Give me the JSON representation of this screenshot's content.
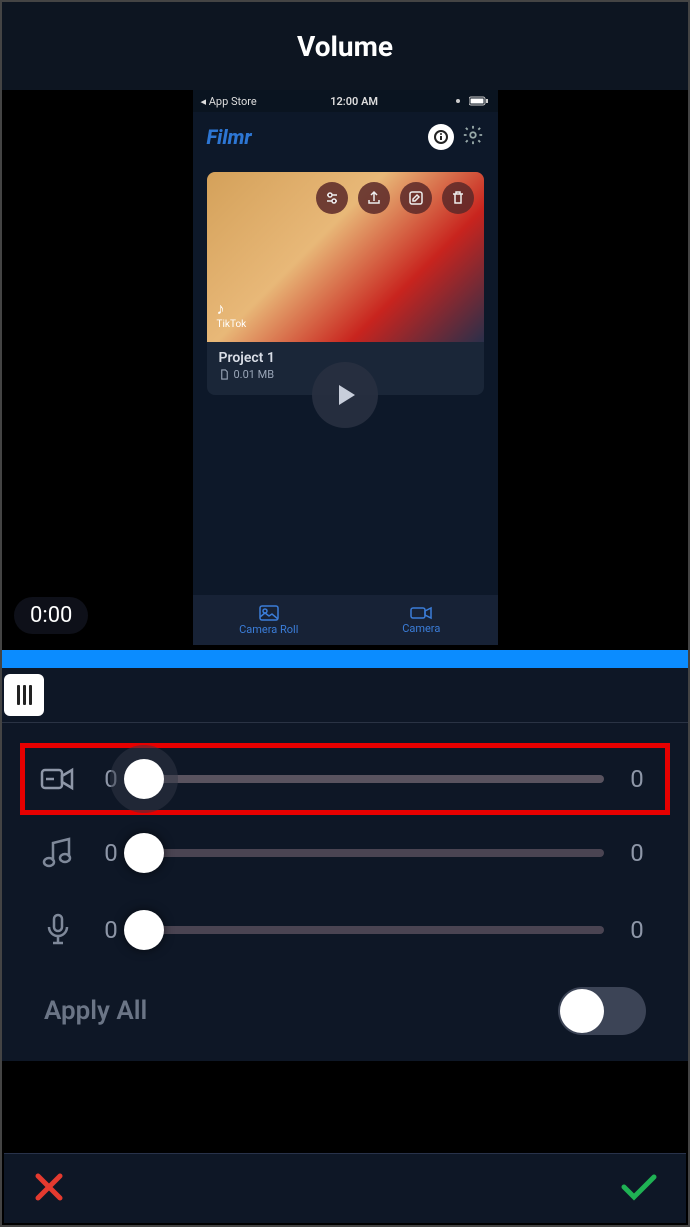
{
  "header": {
    "title": "Volume"
  },
  "preview": {
    "statusbar": {
      "back": "◂ App Store",
      "time": "12:00 AM"
    },
    "appName": "Filmr",
    "project": {
      "name": "Project 1",
      "size": "0.01 MB",
      "watermark": "TikTok"
    },
    "tabs": {
      "roll": "Camera Roll",
      "camera": "Camera"
    },
    "time": "0:00"
  },
  "sliders": {
    "video": {
      "left": "0",
      "right": "0"
    },
    "music": {
      "left": "0",
      "right": "0"
    },
    "mic": {
      "left": "0",
      "right": "0"
    }
  },
  "applyAll": {
    "label": "Apply All",
    "on": false
  }
}
